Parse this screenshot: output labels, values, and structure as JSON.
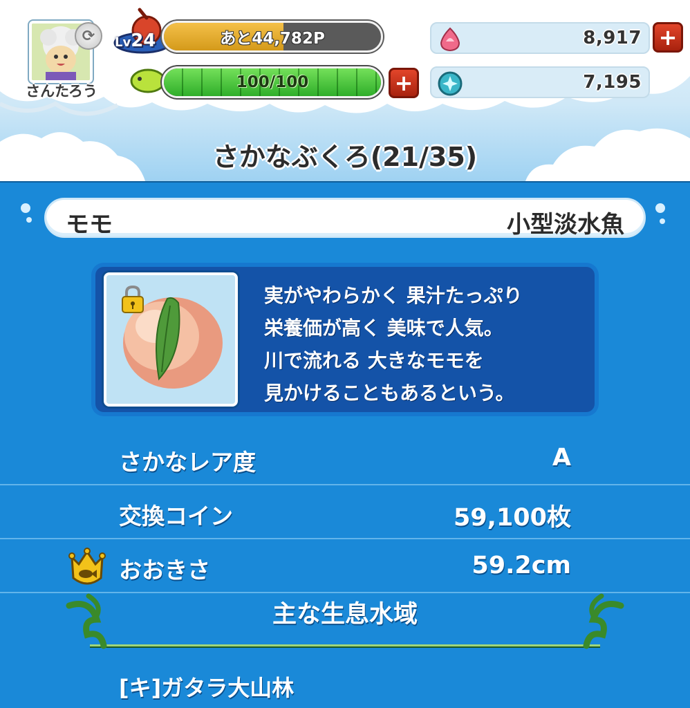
{
  "player": {
    "name": "さんたろう",
    "level_prefix": "Lv",
    "level": "24"
  },
  "exp": {
    "label": "あと44,782P",
    "fill_fraction": 0.55
  },
  "stamina": {
    "label": "100/100",
    "fill_fraction": 1.0
  },
  "currencies": {
    "gems": "8,917",
    "coins": "7,195"
  },
  "screen": {
    "title": "さかなぶくろ(21/35)"
  },
  "fish": {
    "name": "モモ",
    "type": "小型淡水魚",
    "description": [
      "実がやわらかく 果汁たっぷり",
      "栄養価が高く 美味で人気。",
      "川で流れる 大きなモモを",
      "見かけることもあるという。"
    ],
    "icon": "peach-icon",
    "locked": true
  },
  "stats": [
    {
      "label": "さかなレア度",
      "value": "A"
    },
    {
      "label": "交換コイン",
      "value": "59,100枚"
    },
    {
      "label": "おおきさ",
      "value": "59.2cm"
    }
  ],
  "habitat": {
    "title": "主な生息水域",
    "items": [
      "[キ]ガタラ大山林"
    ]
  },
  "colors": {
    "panel_blue": "#1a89d8",
    "card_navy": "#1453a8",
    "plus_red": "#c8321a",
    "stamina_green": "#3fbf35",
    "exp_gold": "#e2ab2d"
  }
}
